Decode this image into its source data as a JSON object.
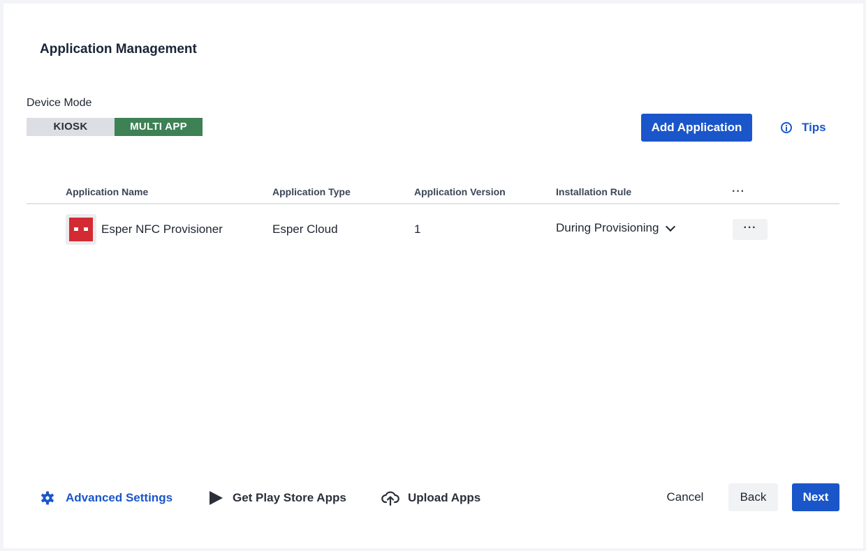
{
  "page": {
    "title": "Application Management"
  },
  "device_mode": {
    "label": "Device Mode",
    "options": [
      "KIOSK",
      "MULTI APP"
    ],
    "selected": "MULTI APP"
  },
  "actions": {
    "add_application": "Add Application",
    "tips": "Tips"
  },
  "table": {
    "columns": [
      "Application Name",
      "Application Type",
      "Application Version",
      "Installation Rule",
      "···"
    ],
    "rows": [
      {
        "name": "Esper NFC Provisioner",
        "type": "Esper Cloud",
        "version": "1",
        "rule": "During Provisioning",
        "more": "···"
      }
    ]
  },
  "footer": {
    "advanced_settings": "Advanced Settings",
    "play_store": "Get Play Store Apps",
    "upload": "Upload Apps",
    "cancel": "Cancel",
    "back": "Back",
    "next": "Next"
  },
  "colors": {
    "primary": "#1a56c9",
    "mode_selected": "#3d8155",
    "mode_unselected": "#dcdee3",
    "app_icon": "#d32a33"
  },
  "icons": [
    "info-icon",
    "chevron-down-icon",
    "gear-icon",
    "play-icon",
    "cloud-upload-icon"
  ]
}
